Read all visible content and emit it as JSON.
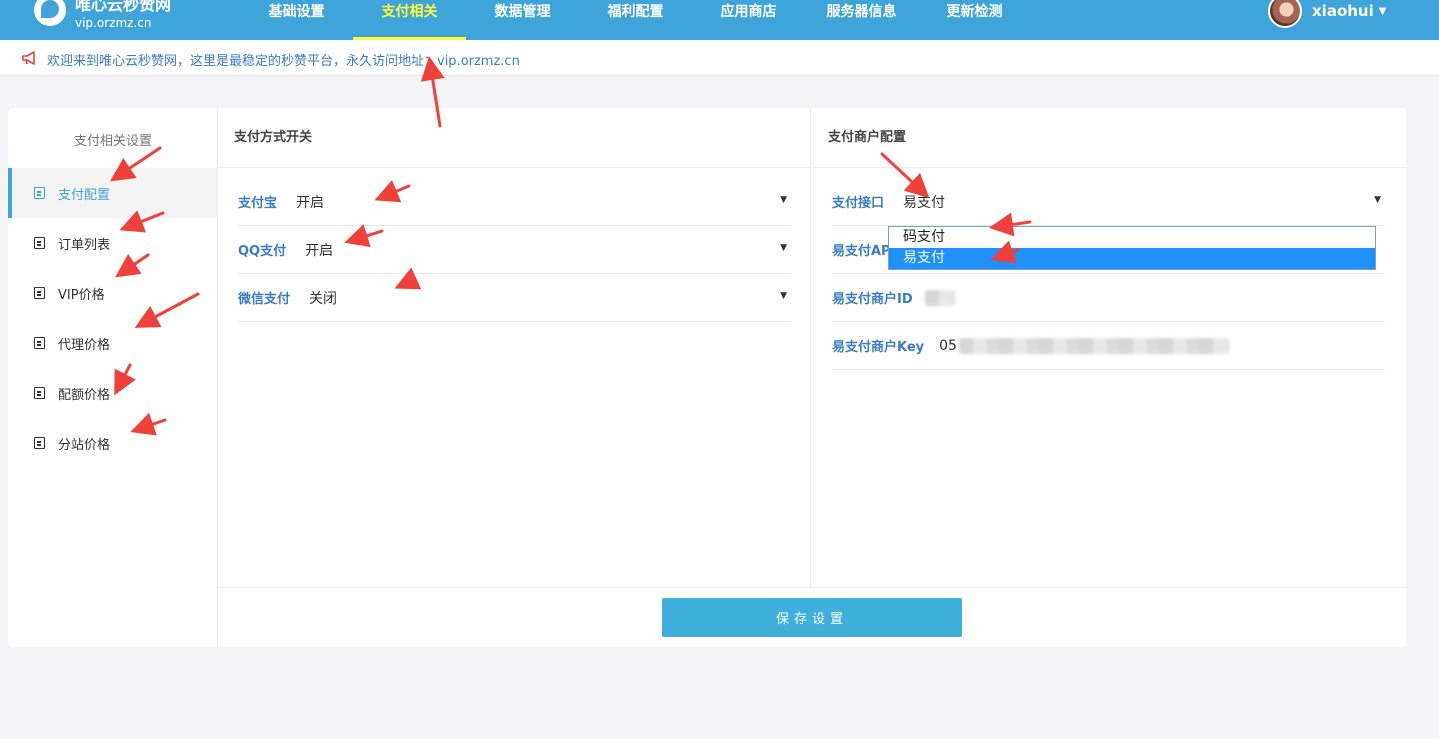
{
  "header": {
    "brand_title": "唯心云秒赞网",
    "brand_url": "vip.orzmz.cn",
    "nav": [
      "基础设置",
      "支付相关",
      "数据管理",
      "福利配置",
      "应用商店",
      "服务器信息",
      "更新检测"
    ],
    "active_nav": "支付相关",
    "username": "xiaohui"
  },
  "notice": {
    "icon": "megaphone-icon",
    "text": "欢迎来到唯心云秒赞网，这里是最稳定的秒赞平台，永久访问地址：vip.orzmz.cn"
  },
  "sidebar": {
    "title": "支付相关设置",
    "items": [
      {
        "label": "支付配置",
        "icon": "document-icon",
        "active": true
      },
      {
        "label": "订单列表",
        "icon": "document-icon"
      },
      {
        "label": "VIP价格",
        "icon": "document-icon"
      },
      {
        "label": "代理价格",
        "icon": "document-icon"
      },
      {
        "label": "配额价格",
        "icon": "document-icon"
      },
      {
        "label": "分站价格",
        "icon": "document-icon"
      }
    ]
  },
  "switches": {
    "title": "支付方式开关",
    "rows": [
      {
        "label": "支付宝",
        "value": "开启"
      },
      {
        "label": "QQ支付",
        "value": "开启"
      },
      {
        "label": "微信支付",
        "value": "关闭"
      }
    ]
  },
  "merchant": {
    "title": "支付商户配置",
    "interface_label": "支付接口",
    "interface_value": "易支付",
    "options": [
      "码支付",
      "易支付"
    ],
    "selected_option": "易支付",
    "api_label": "易支付AP",
    "merchant_id_label": "易支付商户ID",
    "merchant_key_label": "易支付商户Key",
    "merchant_key_prefix": "05"
  },
  "footer": {
    "save_label": "保存设置"
  },
  "colors": {
    "header": "#3fa4d9",
    "active_nav": "#fffb3a",
    "link": "#3b7cc4",
    "button": "#3fb0dc",
    "selected_option": "#1e90ff",
    "annotation_arrow": "#f0403a"
  }
}
